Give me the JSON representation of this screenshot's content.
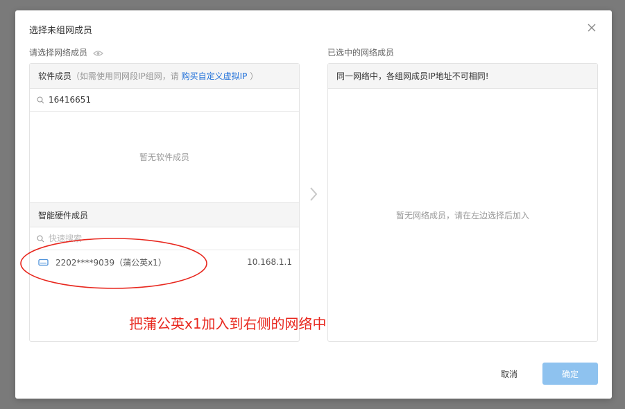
{
  "dialog": {
    "title": "选择未组网成员"
  },
  "left": {
    "label": "请选择网络成员",
    "software": {
      "title": "软件成员",
      "hint_prefix": "（如需使用同网段IP组网，请 ",
      "hint_link": "购买自定义虚拟IP",
      "hint_suffix": " ）",
      "search_value": "16416651",
      "empty_text": "暂无软件成员"
    },
    "hardware": {
      "title": "智能硬件成员",
      "search_placeholder": "快速搜索",
      "members": [
        {
          "name": "2202****9039（蒲公英x1）",
          "ip": "10.168.1.1"
        }
      ]
    }
  },
  "right": {
    "label": "已选中的网络成员",
    "notice": "同一网络中，各组网成员IP地址不可相同!",
    "empty_text": "暂无网络成员，请在左边选择后加入"
  },
  "buttons": {
    "cancel": "取消",
    "ok": "确定"
  },
  "annotation": {
    "text": "把蒲公英x1加入到右侧的网络中",
    "color": "#e8281f"
  },
  "colors": {
    "link": "#1e6fd9",
    "primary_disabled": "#8ec2ef",
    "device_icon": "#4a90d9"
  },
  "icons": {
    "close": "close-icon",
    "eye": "eye-icon",
    "search": "search-icon",
    "device": "router-device-icon",
    "arrow": "chevron-right-icon"
  }
}
